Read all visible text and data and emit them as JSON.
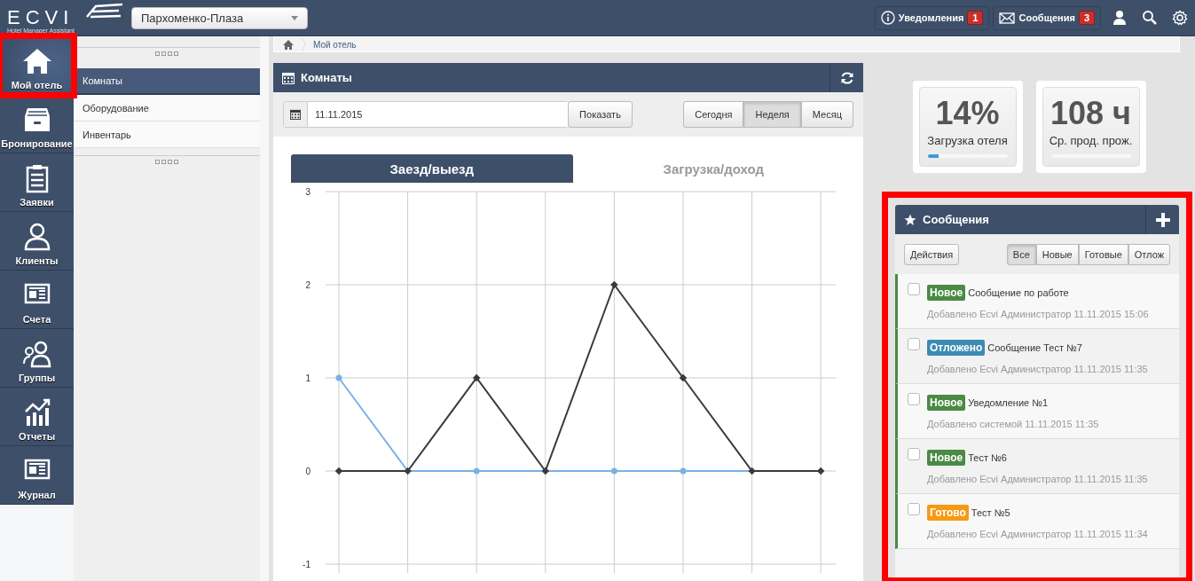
{
  "topbar": {
    "logo": "ECVI",
    "logo_subtitle": "Hotel Manager Assistant",
    "hotel_select": "Пархоменко-Плаза",
    "notifications": {
      "label": "Уведомления",
      "count": "1"
    },
    "messages": {
      "label": "Сообщения",
      "count": "3"
    }
  },
  "nav": [
    {
      "label": "Мой отель",
      "selected": true,
      "highlighted": true
    },
    {
      "label": "Бронирование",
      "selected": false,
      "highlighted": false
    },
    {
      "label": "Заявки",
      "selected": false,
      "highlighted": false
    },
    {
      "label": "Клиенты",
      "selected": false,
      "highlighted": false
    },
    {
      "label": "Счета",
      "selected": false,
      "highlighted": false
    },
    {
      "label": "Группы",
      "selected": false,
      "highlighted": false
    },
    {
      "label": "Отчеты",
      "selected": false,
      "highlighted": false
    },
    {
      "label": "Журнал",
      "selected": false,
      "highlighted": false
    }
  ],
  "subnav": [
    {
      "label": "Комнаты",
      "selected": true
    },
    {
      "label": "Оборудование",
      "selected": false
    },
    {
      "label": "Инвентарь",
      "selected": false
    }
  ],
  "breadcrumb": "Мой отель",
  "rooms_panel": {
    "title": "Комнаты",
    "date": "11.11.2015",
    "show_button": "Показать",
    "periods": [
      {
        "label": "Сегодня",
        "selected": false
      },
      {
        "label": "Неделя",
        "selected": true
      },
      {
        "label": "Месяц",
        "selected": false
      }
    ],
    "chart_tabs": [
      {
        "label": "Заезд/выезд",
        "selected": true
      },
      {
        "label": "Загрузка/доход",
        "selected": false
      }
    ],
    "chart_data": {
      "type": "line",
      "grid": true,
      "ylim": [
        -1,
        3
      ],
      "yticks": [
        -1,
        0,
        1,
        2,
        3
      ],
      "series": [
        {
          "color": "#7ab2e8",
          "marker": "circle",
          "values": [
            1,
            0,
            0,
            0,
            0,
            0,
            0,
            null
          ]
        },
        {
          "color": "#3a3a3a",
          "marker": "diamond",
          "values": [
            0,
            0,
            1,
            0,
            2,
            1,
            0,
            0
          ]
        }
      ]
    }
  },
  "stats": [
    {
      "value": "14%",
      "label": "Загрузка отеля",
      "level": 0.14
    },
    {
      "value": "108 ч",
      "label": "Ср. прод. прож.",
      "level": 0
    }
  ],
  "messages_panel": {
    "title": "Сообщения",
    "highlighted": true,
    "actions_button": "Действия",
    "filters": [
      {
        "label": "Все",
        "selected": true
      },
      {
        "label": "Новые",
        "selected": false
      },
      {
        "label": "Готовые",
        "selected": false
      },
      {
        "label": "Отлож",
        "selected": false
      }
    ],
    "items": [
      {
        "status": "Новое",
        "color": "#4a8a45",
        "title": "Сообщение по работе",
        "meta": "Добавлено Ecvi Администратор 11.11.2015 15:06",
        "checked": false
      },
      {
        "status": "Отложено",
        "color": "#3c8bb3",
        "title": "Сообщение Тест №7",
        "meta": "Добавлено Ecvi Администратор 11.11.2015 11:35",
        "checked": false
      },
      {
        "status": "Новое",
        "color": "#4a8a45",
        "title": "Уведомление №1",
        "meta": "Добавлено системой 11.11.2015 11:35",
        "checked": false
      },
      {
        "status": "Новое",
        "color": "#4a8a45",
        "title": "Тест №6",
        "meta": "Добавлено Ecvi Администратор 11.11.2015 11:35",
        "checked": false
      },
      {
        "status": "Готово",
        "color": "#f59a14",
        "title": "Тест №5",
        "meta": "Добавлено Ecvi Администратор 11.11.2015 11:34",
        "checked": false
      }
    ]
  }
}
